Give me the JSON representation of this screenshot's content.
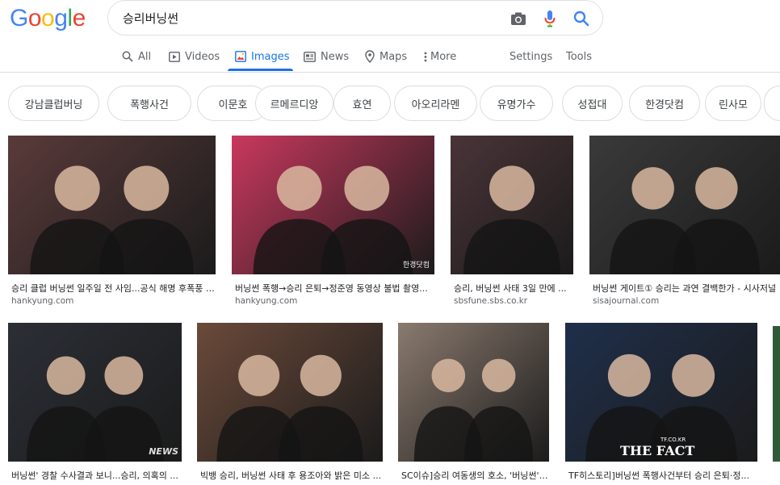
{
  "logo": {
    "text": "Google"
  },
  "search": {
    "query": "승리버닝썬"
  },
  "tabs": [
    {
      "label": "All",
      "icon": "search-icon"
    },
    {
      "label": "Videos",
      "icon": "video-icon"
    },
    {
      "label": "Images",
      "icon": "image-icon",
      "active": true
    },
    {
      "label": "News",
      "icon": "news-icon"
    },
    {
      "label": "Maps",
      "icon": "map-pin-icon"
    },
    {
      "label": "More",
      "icon": "more-vert-icon"
    },
    {
      "label": "Settings"
    },
    {
      "label": "Tools"
    }
  ],
  "chips": [
    "강남클럽버닝",
    "폭행사건",
    "이문호",
    "르메르디앙",
    "효연",
    "아오리라멘",
    "유명가수",
    "성접대",
    "한경닷컴",
    "린사모"
  ],
  "results": [
    {
      "caption": "승리 클럽 버닝썬 일주일 전 사임...공식 해명 후폭풍 |...",
      "source": "hankyung.com",
      "color": "#5a3a3a"
    },
    {
      "caption": "버닝썬 폭행→승리 은퇴→정준영 동영상 불법 촬영...",
      "source": "hankyung.com",
      "color": "#c9385e",
      "overlay": "한경닷컴"
    },
    {
      "caption": "승리, 버닝썬 사태 3일 만에 ...",
      "source": "sbsfune.sbs.co.kr",
      "color": "#4a3438"
    },
    {
      "caption": "버닝썬 게이트① 승리는 과연 결백한가 - 시사저널",
      "source": "sisajournal.com",
      "color": "#3a3a3a"
    },
    {
      "caption": "버닝썬' 경찰 수사결과 보니...승리, 의혹의 ...",
      "source": "",
      "color": "#2b2f36",
      "overlay": "NEWS"
    },
    {
      "caption": "빅뱅 승리, 버닝썬 사태 후 용조아와 밝은 미소 ...",
      "source": "",
      "color": "#6b4a3a"
    },
    {
      "caption": "SC이슈]승리 여동생의 호소, '버닝썬' ...",
      "source": "",
      "color": "#8a7a6e"
    },
    {
      "caption": "TF히스토리]버닝썬 폭행사건부터 승리 은퇴·정...",
      "source": "",
      "color": "#1f2f4a",
      "overlay": "THE FACT",
      "overlay2": "TF.CO.KR"
    }
  ],
  "colors": {
    "accent": "#1a73e8"
  }
}
